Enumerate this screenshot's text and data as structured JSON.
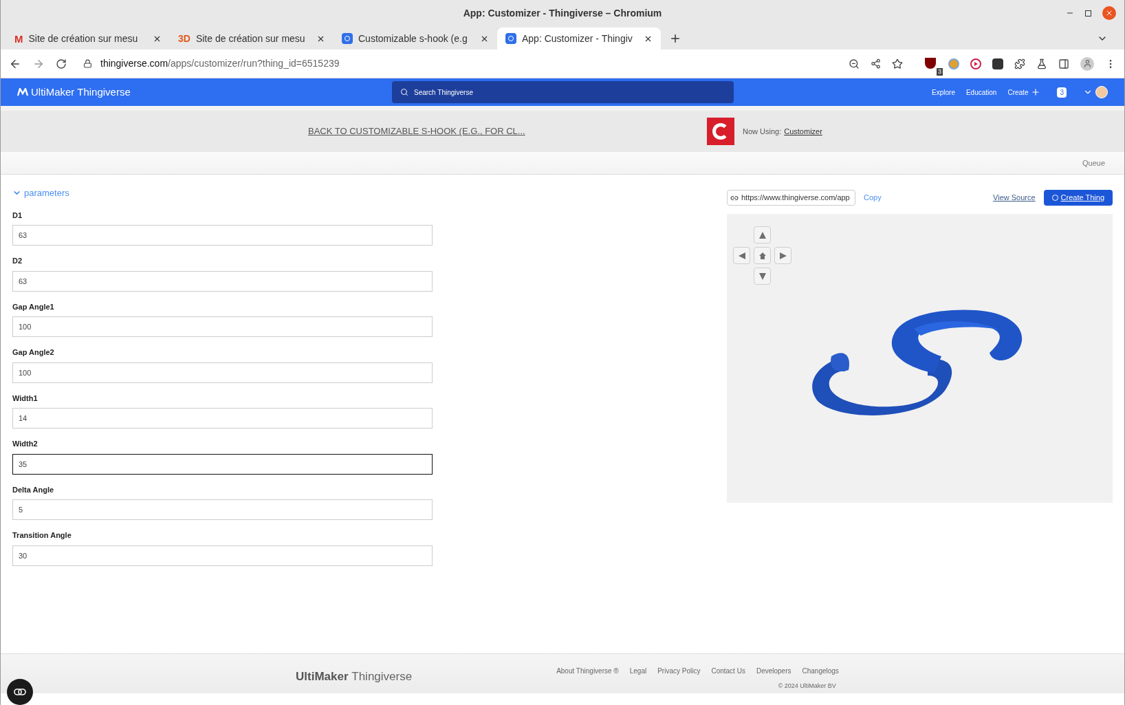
{
  "window": {
    "title": "App: Customizer - Thingiverse – Chromium"
  },
  "tabs": [
    {
      "label": "Site de création sur mesu",
      "kind": "mail",
      "icon_text": "M",
      "selected": false
    },
    {
      "label": "Site de création sur mesu",
      "kind": "lettered",
      "icon_text": "3D",
      "selected": false
    },
    {
      "label": "Customizable s-hook (e.g",
      "kind": "site",
      "selected": false
    },
    {
      "label": "App: Customizer - Thingiv",
      "kind": "site",
      "selected": true
    }
  ],
  "address": {
    "host": "thingiverse.com",
    "path": "/apps/customizer/run?thing_id=6515239"
  },
  "extension_badge": "3",
  "header": {
    "brand": "UltiMaker Thingiverse",
    "search_placeholder": "Search Thingiverse",
    "nav": [
      "Explore",
      "Education",
      "Create"
    ],
    "notifications": "3"
  },
  "back_link": "BACK TO CUSTOMIZABLE S-HOOK (E.G., FOR CL...",
  "now_using": {
    "label": "Now Using:",
    "app": "Customizer"
  },
  "queue": "Queue",
  "parameters": {
    "title": "parameters",
    "expanded": true,
    "fields": [
      {
        "label": "D1",
        "value": "63",
        "focused": false
      },
      {
        "label": "D2",
        "value": "63",
        "focused": false
      },
      {
        "label": "Gap Angle1",
        "value": "100",
        "focused": false
      },
      {
        "label": "Gap Angle2",
        "value": "100",
        "focused": false
      },
      {
        "label": "Width1",
        "value": "14",
        "focused": false
      },
      {
        "label": "Width2",
        "value": "35",
        "focused": true
      },
      {
        "label": "Delta Angle",
        "value": "5",
        "focused": false
      },
      {
        "label": "Transition Angle",
        "value": "30",
        "focused": false
      }
    ]
  },
  "share": {
    "url": "https://www.thingiverse.com/app",
    "copy": "Copy",
    "view_source": "View Source",
    "create": "Create Thing"
  },
  "footer": {
    "brand_bold": "UltiMaker",
    "brand_light": "Thingiverse",
    "links": [
      "About Thingiverse ®",
      "Legal",
      "Privacy Policy",
      "Contact Us",
      "Developers",
      "Changelogs"
    ],
    "copyright": "© 2024 UltiMaker BV"
  }
}
